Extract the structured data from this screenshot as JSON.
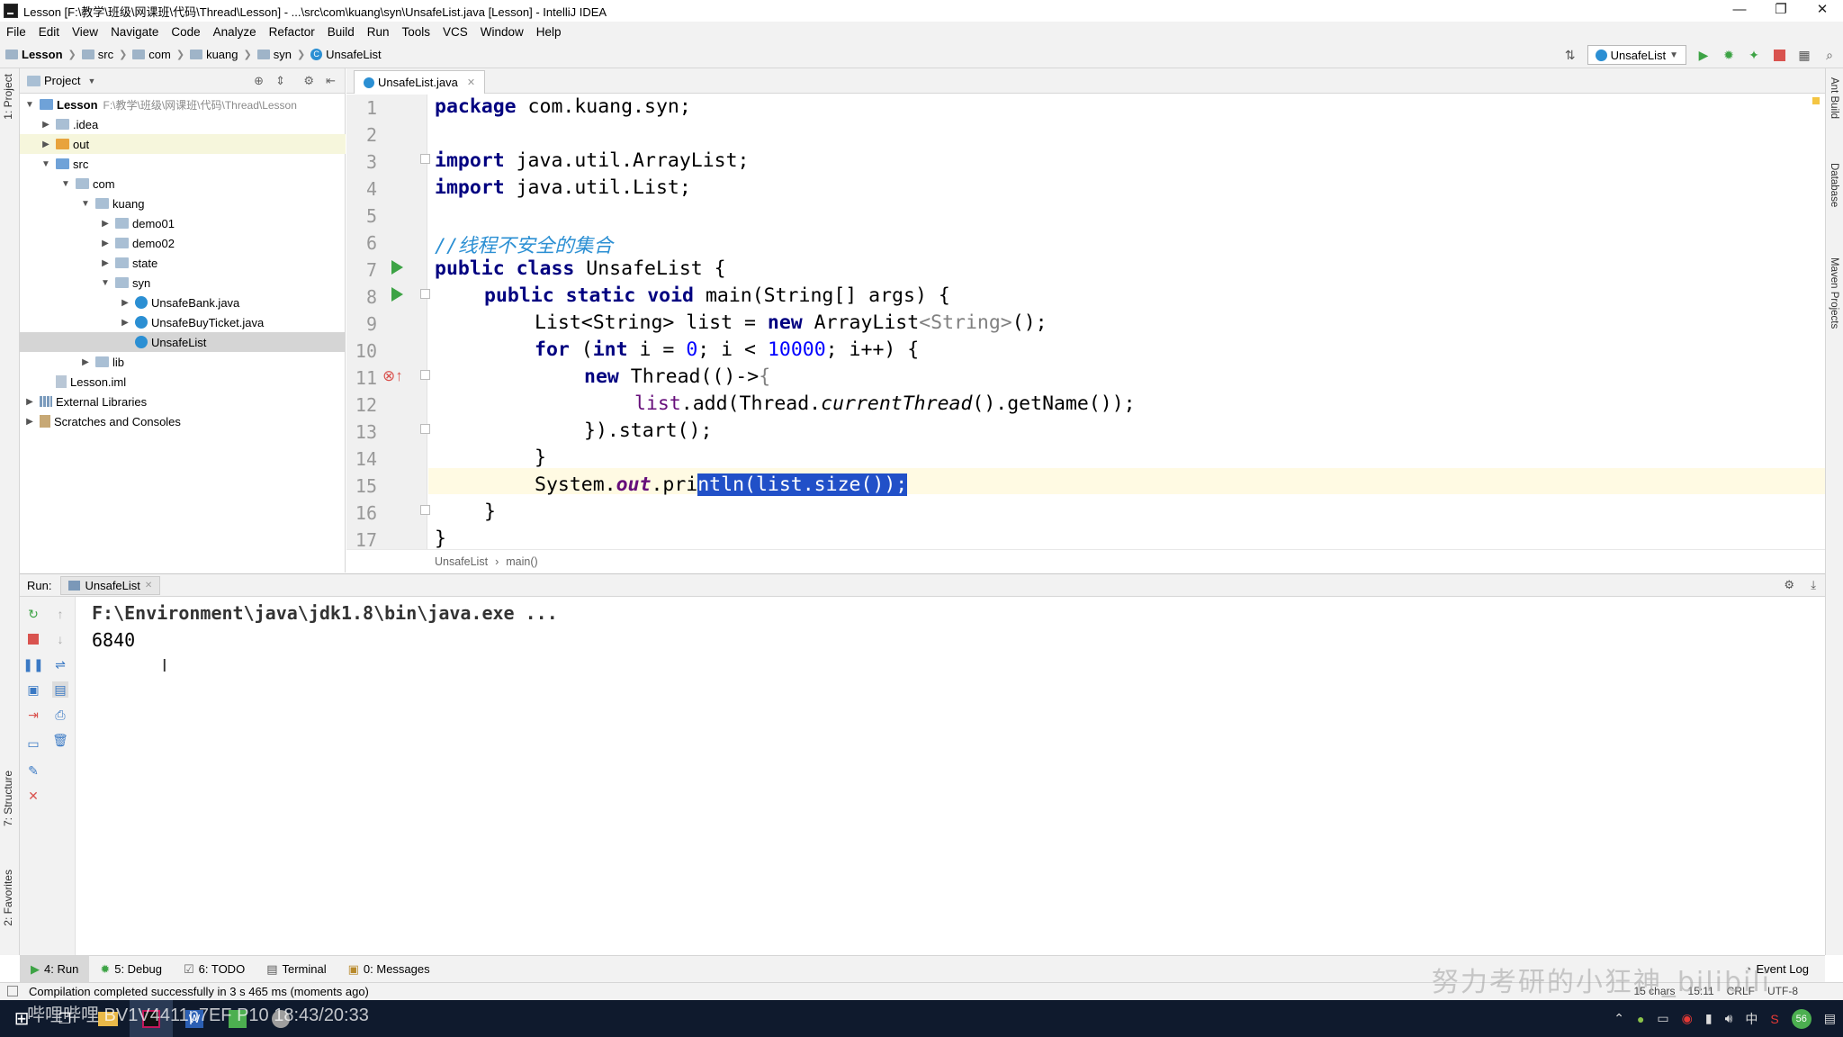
{
  "window": {
    "title": "Lesson [F:\\教学\\班级\\网课班\\代码\\Thread\\Lesson] - ...\\src\\com\\kuang\\syn\\UnsafeList.java [Lesson] - IntelliJ IDEA",
    "minimize": "—",
    "maximize": "❐",
    "close": "✕"
  },
  "menu": [
    "File",
    "Edit",
    "View",
    "Navigate",
    "Code",
    "Analyze",
    "Refactor",
    "Build",
    "Run",
    "Tools",
    "VCS",
    "Window",
    "Help"
  ],
  "breadcrumb": [
    "Lesson",
    "src",
    "com",
    "kuang",
    "syn",
    "UnsafeList"
  ],
  "toolbar": {
    "run_config": "UnsafeList"
  },
  "left_stripe": {
    "project": "1: Project",
    "structure": "7: Structure",
    "favorites": "2: Favorites"
  },
  "right_stripe": {
    "ant": "Ant Build",
    "database": "Database",
    "maven": "Maven Projects"
  },
  "project_panel": {
    "title": "Project",
    "tree": [
      {
        "label": "Lesson",
        "path": "F:\\教学\\班级\\网课班\\代码\\Thread\\Lesson"
      },
      {
        "label": ".idea"
      },
      {
        "label": "out"
      },
      {
        "label": "src"
      },
      {
        "label": "com"
      },
      {
        "label": "kuang"
      },
      {
        "label": "demo01"
      },
      {
        "label": "demo02"
      },
      {
        "label": "state"
      },
      {
        "label": "syn"
      },
      {
        "label": "UnsafeBank.java"
      },
      {
        "label": "UnsafeBuyTicket.java"
      },
      {
        "label": "UnsafeList"
      },
      {
        "label": "lib"
      },
      {
        "label": "Lesson.iml"
      },
      {
        "label": "External Libraries"
      },
      {
        "label": "Scratches and Consoles"
      }
    ]
  },
  "editor": {
    "tab": "UnsafeList.java",
    "line_numbers": [
      "1",
      "2",
      "3",
      "4",
      "5",
      "6",
      "7",
      "8",
      "9",
      "10",
      "11",
      "12",
      "13",
      "14",
      "15",
      "16",
      "17"
    ],
    "code": {
      "l1a": "package",
      "l1b": " com.kuang.syn;",
      "l3a": "import",
      "l3b": " java.util.ArrayList;",
      "l4a": "import",
      "l4b": " java.util.List;",
      "l6": "//线程不安全的集合",
      "l7a": "public class",
      "l7b": " UnsafeList {",
      "l8a": "public static void",
      "l8b": " main(String[] args) {",
      "l9a": "List<String> list = ",
      "l9b": "new",
      "l9c": " ArrayList",
      "l9d": "<String>",
      "l9e": "();",
      "l10a": "for",
      "l10b": " (",
      "l10c": "int",
      "l10d": " i = ",
      "l10e": "0",
      "l10f": "; i < ",
      "l10g": "10000",
      "l10h": "; i++) {",
      "l11a": "new",
      "l11b": " Thread(()->",
      "l11c": "{",
      "l12a": "list",
      "l12b": ".add(Thread.",
      "l12c": "currentThread",
      "l12d": "().getName());",
      "l13": "}).start();",
      "l14": "}",
      "l15a": "System.",
      "l15b": "out",
      "l15c": ".pri",
      "l15d": "ntln(list.size());",
      "l16": "}",
      "l17": "}"
    },
    "crumb": [
      "UnsafeList",
      "main()"
    ]
  },
  "run_panel": {
    "label": "Run:",
    "tab": "UnsafeList",
    "console": [
      "F:\\Environment\\java\\jdk1.8\\bin\\java.exe ...",
      "6840"
    ]
  },
  "bottom_tabs": [
    "4: Run",
    "5: Debug",
    "6: TODO",
    "Terminal",
    "0: Messages"
  ],
  "event_log": "Event Log",
  "status": {
    "message": "Compilation completed successfully in 3 s 465 ms (moments ago)",
    "right": [
      "15 chars",
      "15:11",
      "CRLF",
      "UTF-8"
    ]
  },
  "taskbar_overlay": "哔哩哔哩 BV1V4411p7EF P10 18:43/20:33",
  "watermark": "努力考研的小狂神_bilibili",
  "tray": {
    "ime": "中",
    "badge": "56"
  }
}
